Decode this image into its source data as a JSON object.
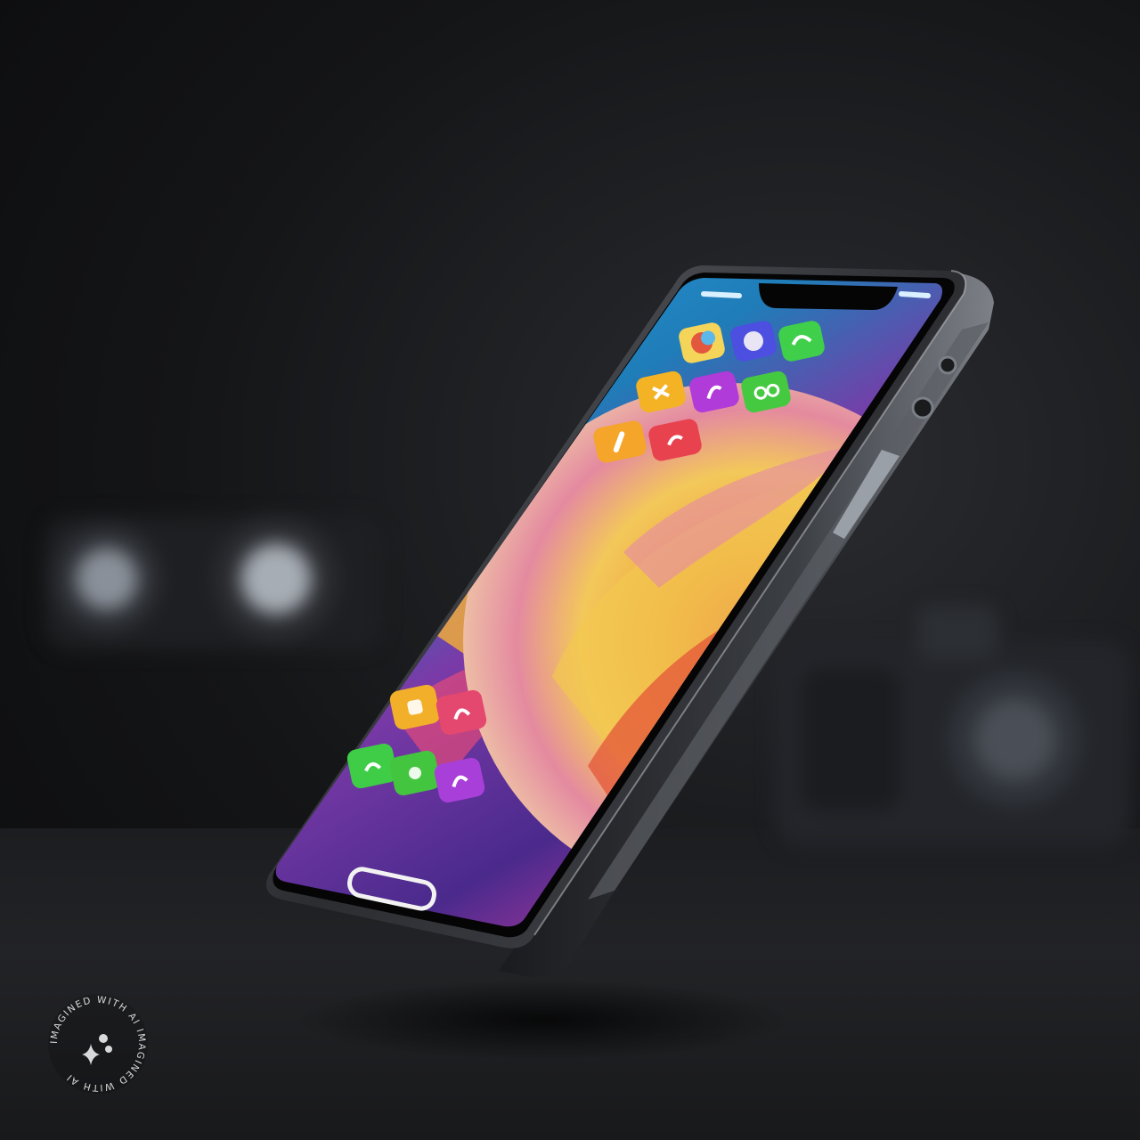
{
  "image": {
    "subject": "smartphone",
    "background_color": "#121314",
    "accent_colors": [
      "#2aa6e0",
      "#f2b233",
      "#e6445f",
      "#a23fd6",
      "#5dd34a"
    ]
  },
  "home_screen": {
    "icons": [
      {
        "name": "photos-icon",
        "color": "#f5d45a"
      },
      {
        "name": "gallery-icon",
        "color": "#4c4fe0"
      },
      {
        "name": "phone-icon",
        "color": "#3fcf4a"
      },
      {
        "name": "app-icon-1",
        "color": "#f3b324"
      },
      {
        "name": "app-icon-2",
        "color": "#b03bd8"
      },
      {
        "name": "app-icon-3",
        "color": "#45c940"
      },
      {
        "name": "app-icon-4",
        "color": "#f5a52a"
      },
      {
        "name": "app-icon-5",
        "color": "#e8424f"
      },
      {
        "name": "app-icon-6",
        "color": "#f2b02a"
      },
      {
        "name": "app-icon-7",
        "color": "#e5486e"
      },
      {
        "name": "app-icon-8",
        "color": "#3fcd47"
      },
      {
        "name": "app-icon-9",
        "color": "#44c540"
      },
      {
        "name": "app-icon-10",
        "color": "#a83fd8"
      }
    ]
  },
  "watermark": {
    "text": "IMAGINED WITH AI IMAGINED WITH AI",
    "icon": "sparkle-icon"
  }
}
